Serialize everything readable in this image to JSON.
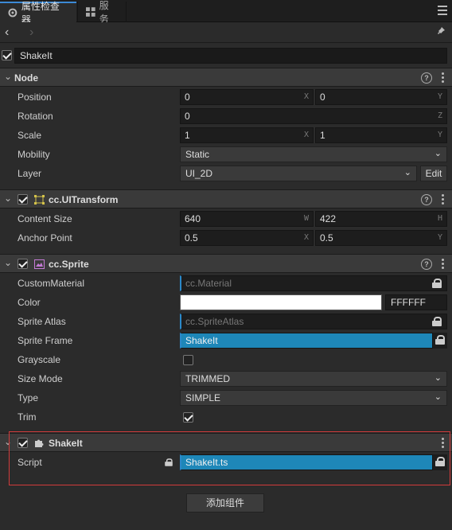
{
  "tabs": [
    {
      "label": "属性检查器",
      "icon": "gear-icon"
    },
    {
      "label": "服务",
      "icon": "grid-icon"
    }
  ],
  "node": {
    "name": "ShakeIt",
    "enabled": true
  },
  "sections": {
    "node": {
      "title": "Node",
      "position": {
        "x": "0",
        "y": "0",
        "x_axis": "X",
        "y_axis": "Y"
      },
      "rotation": {
        "z": "0",
        "z_axis": "Z"
      },
      "scale": {
        "x": "1",
        "y": "1",
        "x_axis": "X",
        "y_axis": "Y"
      },
      "mobility": "Static",
      "layer": "UI_2D",
      "edit_label": "Edit",
      "labels": {
        "position": "Position",
        "rotation": "Rotation",
        "scale": "Scale",
        "mobility": "Mobility",
        "layer": "Layer"
      }
    },
    "uitransform": {
      "title": "cc.UITransform",
      "enabled": true,
      "content_size": {
        "w": "640",
        "h": "422",
        "w_axis": "W",
        "h_axis": "H"
      },
      "anchor_point": {
        "x": "0.5",
        "y": "0.5",
        "x_axis": "X",
        "y_axis": "Y"
      },
      "labels": {
        "content_size": "Content Size",
        "anchor_point": "Anchor Point"
      }
    },
    "sprite": {
      "title": "cc.Sprite",
      "enabled": true,
      "custom_material_placeholder": "cc.Material",
      "color_hex": "FFFFFF",
      "sprite_atlas_placeholder": "cc.SpriteAtlas",
      "sprite_frame": "ShakeIt",
      "grayscale": false,
      "size_mode": "TRIMMED",
      "type": "SIMPLE",
      "trim": true,
      "labels": {
        "custom_material": "CustomMaterial",
        "color": "Color",
        "sprite_atlas": "Sprite Atlas",
        "sprite_frame": "Sprite Frame",
        "grayscale": "Grayscale",
        "size_mode": "Size Mode",
        "type": "Type",
        "trim": "Trim"
      }
    },
    "shakeit": {
      "title": "ShakeIt",
      "enabled": true,
      "script": "ShakeIt.ts",
      "labels": {
        "script": "Script"
      }
    }
  },
  "add_component_label": "添加组件",
  "colors": {
    "accent": "#1e87b8",
    "highlight": "#d23b3b",
    "background": "#2b2b2b"
  }
}
